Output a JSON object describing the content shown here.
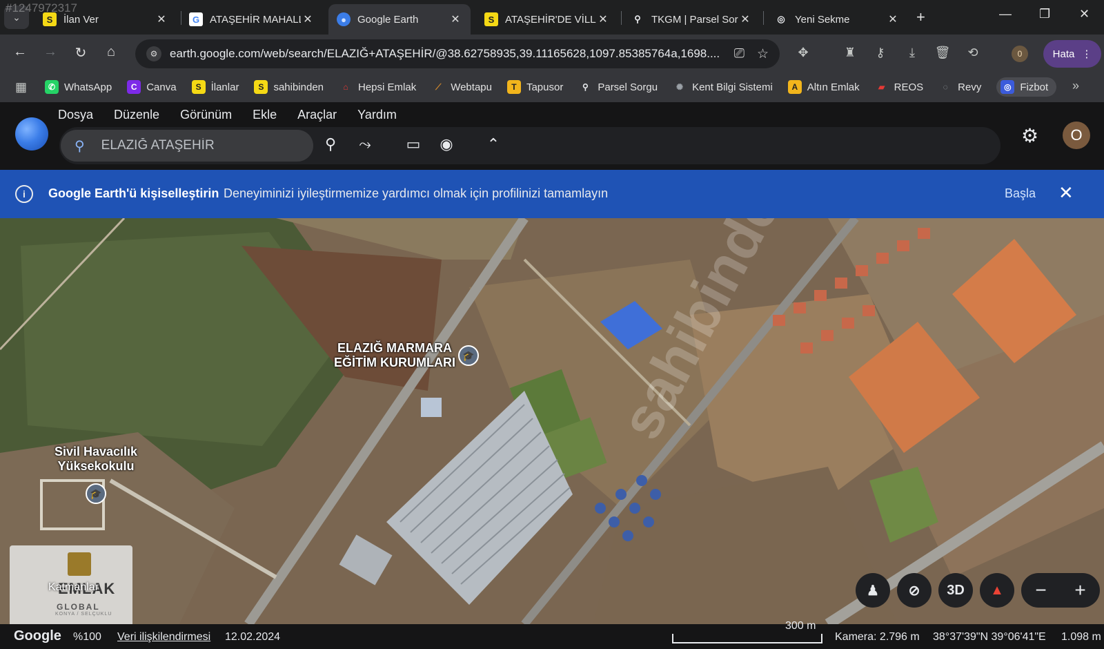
{
  "browser": {
    "tabs": [
      {
        "label": "İlan Ver",
        "favicon": "S",
        "favicon_bg": "#f5d915",
        "favicon_fg": "#222"
      },
      {
        "label": "ATAŞEHİR MAHALLE",
        "favicon": "G",
        "favicon_bg": "#ffffff",
        "favicon_fg": "#4285f4"
      },
      {
        "label": "Google Earth",
        "favicon": "●",
        "favicon_bg": "#3b7de8",
        "favicon_fg": "#cfe1ff"
      },
      {
        "label": "ATAŞEHİR'DE VİLLA",
        "favicon": "S",
        "favicon_bg": "#f5d915",
        "favicon_fg": "#222"
      },
      {
        "label": "TKGM | Parsel Sorgu",
        "favicon": "⚲",
        "favicon_bg": "transparent",
        "favicon_fg": "#e8eaed"
      },
      {
        "label": "Yeni Sekme",
        "favicon": "◎",
        "favicon_bg": "transparent",
        "favicon_fg": "#e8eaed"
      }
    ],
    "active_tab_index": 2,
    "url": "earth.google.com/web/search/ELAZIĞ+ATAŞEHİR/@38.62758935,39.11165628,1097.85385764a,1698....",
    "profile_initial": "0",
    "hata_label": "Hata",
    "corner_id": "#1247972317"
  },
  "bookmarks": [
    {
      "label": "WhatsApp",
      "icon": "whatsapp-icon",
      "glyph": "✆",
      "bg": "#25d366",
      "fg": "#fff"
    },
    {
      "label": "Canva",
      "icon": "canva-icon",
      "glyph": "C",
      "bg": "#7d2ae8",
      "fg": "#fff"
    },
    {
      "label": "İlanlar",
      "icon": "sahibinden-icon",
      "glyph": "S",
      "bg": "#f5d915",
      "fg": "#222"
    },
    {
      "label": "sahibinden",
      "icon": "sahibinden-icon",
      "glyph": "S",
      "bg": "#f5d915",
      "fg": "#222"
    },
    {
      "label": "Hepsi Emlak",
      "icon": "hepsiemlak-icon",
      "glyph": "⌂",
      "bg": "transparent",
      "fg": "#e53935"
    },
    {
      "label": "Webtapu",
      "icon": "webtapu-icon",
      "glyph": "⟋",
      "bg": "transparent",
      "fg": "#d48a2c"
    },
    {
      "label": "Tapusor",
      "icon": "tapusor-icon",
      "glyph": "T",
      "bg": "#f2b51c",
      "fg": "#222"
    },
    {
      "label": "Parsel Sorgu",
      "icon": "map-pin-icon",
      "glyph": "⚲",
      "bg": "transparent",
      "fg": "#e8eaed"
    },
    {
      "label": "Kent Bilgi Sistemi",
      "icon": "kent-bilgi-icon",
      "glyph": "✺",
      "bg": "transparent",
      "fg": "#9aa0a6"
    },
    {
      "label": "Altın Emlak",
      "icon": "altin-emlak-icon",
      "glyph": "A",
      "bg": "#f2b51c",
      "fg": "#222"
    },
    {
      "label": "REOS",
      "icon": "reos-icon",
      "glyph": "▰",
      "bg": "transparent",
      "fg": "#e53935"
    },
    {
      "label": "Revy",
      "icon": "revy-icon",
      "glyph": "◌",
      "bg": "transparent",
      "fg": "#9aa0a6"
    },
    {
      "label": "Fizbot",
      "icon": "fizbot-icon",
      "glyph": "◎",
      "bg": "#3b5bdb",
      "fg": "#fff"
    }
  ],
  "earth": {
    "menu": [
      "Dosya",
      "Düzenle",
      "Görünüm",
      "Ekle",
      "Araçlar",
      "Yardım"
    ],
    "search_value": "ELAZIĞ ATAŞEHİR",
    "avatar_initial": "O",
    "banner": {
      "title": "Google Earth'ü kişiselleştirin",
      "description": "Deneyiminizi iyileştirmemize yardımcı olmak için profilinizi tamamlayın",
      "start_label": "Başla"
    },
    "map_labels": {
      "school_line1": "ELAZIĞ MARMARA",
      "school_line2": "EĞİTİM KURUMLARI",
      "aviation_line1": "Sivil Havacılık",
      "aviation_line2": "Yüksekokulu"
    },
    "watermark": "sahibinden.com",
    "layers_label": "Katmanlar",
    "overlay_logo_text": "EMLAK",
    "overlay_logo_sub": "GLOBAL",
    "overlay_logo_tiny": "KONYA / SELÇUKLU",
    "view_3d_label": "3D",
    "status": {
      "google": "Google",
      "percent": "%100",
      "data_attribution": "Veri ilişkilendirmesi",
      "date": "12.02.2024",
      "scale": "300 m",
      "camera": "Kamera: 2.796 m",
      "coords": "38°37'39\"N 39°06'41\"E",
      "elevation": "1.098 m"
    }
  }
}
